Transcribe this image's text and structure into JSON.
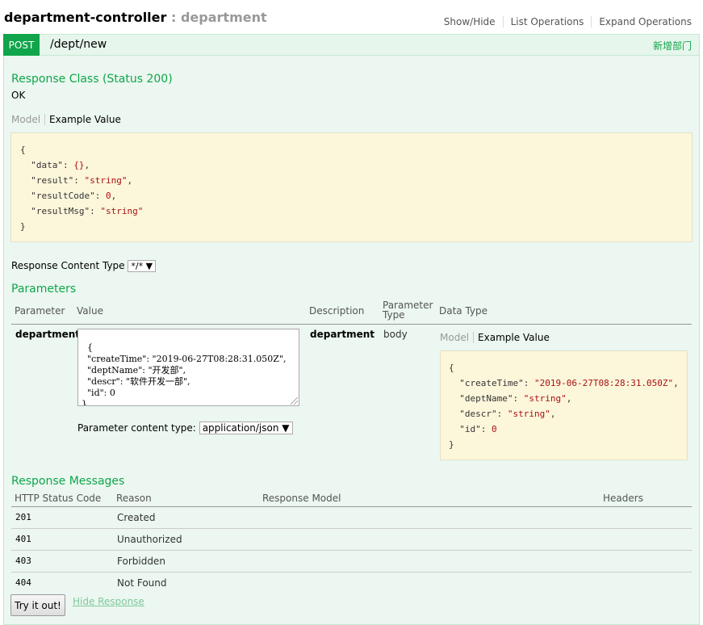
{
  "controller": {
    "name": "department-controller",
    "separator": ":",
    "description": "department"
  },
  "header_links": [
    "Show/Hide",
    "List Operations",
    "Expand Operations"
  ],
  "operation": {
    "method": "POST",
    "path": "/dept/new",
    "summary": "新增部门"
  },
  "response_class": {
    "title": "Response Class (Status 200)",
    "text": "OK",
    "tab_model": "Model",
    "tab_example": "Example Value",
    "example": {
      "open": "{",
      "lines": [
        {
          "key": "\"data\"",
          "sep": ": ",
          "val": "{}",
          "end": ","
        },
        {
          "key": "\"result\"",
          "sep": ": ",
          "val": "\"string\"",
          "end": ","
        },
        {
          "key": "\"resultCode\"",
          "sep": ": ",
          "val": "0",
          "end": ","
        },
        {
          "key": "\"resultMsg\"",
          "sep": ": ",
          "val": "\"string\"",
          "end": ""
        }
      ],
      "close": "}"
    }
  },
  "response_content_type": {
    "label": "Response Content Type",
    "value": "*/*"
  },
  "parameters": {
    "title": "Parameters",
    "headers": {
      "parameter": "Parameter",
      "value": "Value",
      "description": "Description",
      "parameter_type_1": "Parameter",
      "parameter_type_2": "Type",
      "data_type": "Data Type"
    },
    "row": {
      "name": "department",
      "value_text": "{\n  \"createTime\": \"2019-06-27T08:28:31.050Z\",\n  \"deptName\": \"开发部\",\n  \"descr\": \"软件开发一部\",\n  \"id\": 0\n}",
      "description": "department",
      "param_type": "body",
      "tab_model": "Model",
      "tab_example": "Example Value",
      "content_type_label": "Parameter content type:",
      "content_type_value": "application/json",
      "example": {
        "open": "{",
        "lines": [
          {
            "key": "\"createTime\"",
            "sep": ": ",
            "val": "\"2019-06-27T08:28:31.050Z\"",
            "end": ","
          },
          {
            "key": "\"deptName\"",
            "sep": ": ",
            "val": "\"string\"",
            "end": ","
          },
          {
            "key": "\"descr\"",
            "sep": ": ",
            "val": "\"string\"",
            "end": ","
          },
          {
            "key": "\"id\"",
            "sep": ": ",
            "val": "0",
            "end": ""
          }
        ],
        "close": "}"
      }
    }
  },
  "response_messages": {
    "title": "Response Messages",
    "headers": {
      "status": "HTTP Status Code",
      "reason": "Reason",
      "model": "Response Model",
      "headers": "Headers"
    },
    "rows": [
      {
        "code": "201",
        "reason": "Created"
      },
      {
        "code": "401",
        "reason": "Unauthorized"
      },
      {
        "code": "403",
        "reason": "Forbidden"
      },
      {
        "code": "404",
        "reason": "Not Found"
      }
    ]
  },
  "actions": {
    "try_label": "Try it out!",
    "hide_label": "Hide Response"
  },
  "colors": {
    "post_green": "#10a54a",
    "op_bg": "#ebf7f0",
    "code_bg": "#fcf6db"
  }
}
